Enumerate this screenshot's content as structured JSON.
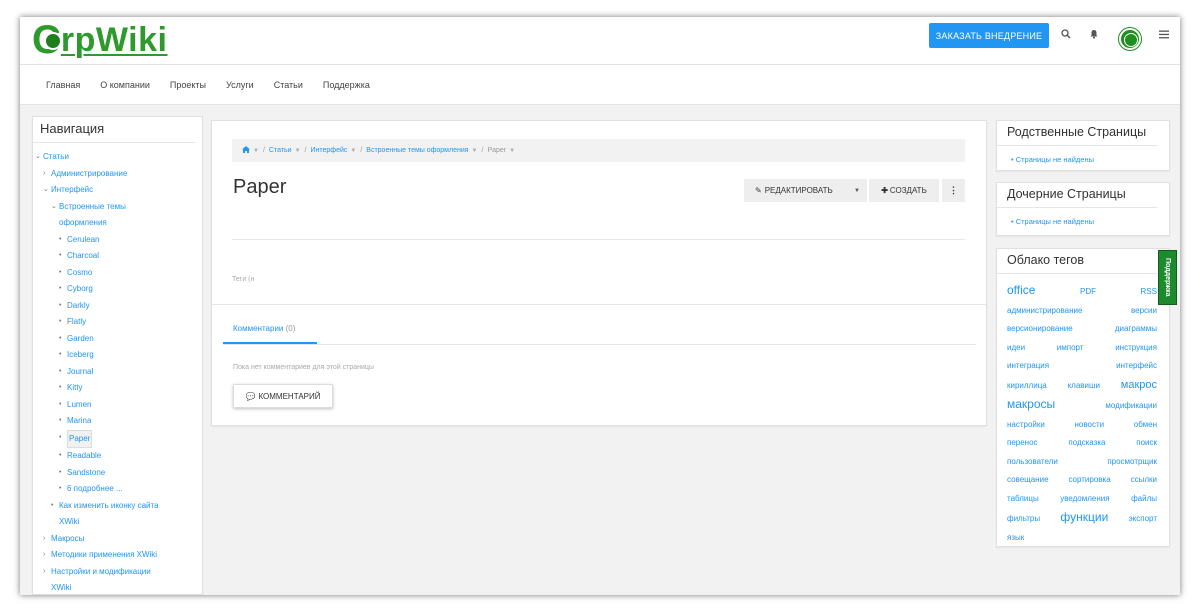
{
  "header": {
    "logo_text": "rpWiki",
    "logo_letter": "C",
    "order_button": "ЗАКАЗАТЬ ВНЕДРЕНИЕ",
    "icons": [
      "search-icon",
      "bell-icon",
      "avatar",
      "menu-icon"
    ]
  },
  "navbar": {
    "items": [
      "Главная",
      "О компании",
      "Проекты",
      "Услуги",
      "Статьи",
      "Поддержка"
    ]
  },
  "sidebar": {
    "title": "Навигация",
    "items": [
      {
        "label": "Статьи",
        "marker": "⌄",
        "indent": 0
      },
      {
        "label": "Администрирование",
        "marker": "›",
        "indent": 1
      },
      {
        "label": "Интерфейс",
        "marker": "⌄",
        "indent": 1
      },
      {
        "label": "Встроенные темы\nоформления",
        "marker": "⌄",
        "indent": 2
      },
      {
        "label": "Cerulean",
        "marker": "•",
        "indent": 3
      },
      {
        "label": "Charcoal",
        "marker": "•",
        "indent": 3
      },
      {
        "label": "Cosmo",
        "marker": "•",
        "indent": 3
      },
      {
        "label": "Cyborg",
        "marker": "•",
        "indent": 3
      },
      {
        "label": "Darkly",
        "marker": "•",
        "indent": 3
      },
      {
        "label": "Flatly",
        "marker": "•",
        "indent": 3
      },
      {
        "label": "Garden",
        "marker": "•",
        "indent": 3
      },
      {
        "label": "Iceberg",
        "marker": "•",
        "indent": 3
      },
      {
        "label": "Journal",
        "marker": "•",
        "indent": 3
      },
      {
        "label": "Kitty",
        "marker": "•",
        "indent": 3
      },
      {
        "label": "Lumen",
        "marker": "•",
        "indent": 3
      },
      {
        "label": "Marina",
        "marker": "•",
        "indent": 3
      },
      {
        "label": "Paper",
        "marker": "•",
        "indent": 3,
        "selected": true
      },
      {
        "label": "Readable",
        "marker": "•",
        "indent": 3
      },
      {
        "label": "Sandstone",
        "marker": "•",
        "indent": 3
      },
      {
        "label": "6 подробнее ...",
        "marker": "•",
        "indent": 3
      },
      {
        "label": "Как изменить иконку сайта\nXWiki",
        "marker": "•",
        "indent": 2
      },
      {
        "label": "Макросы",
        "marker": "›",
        "indent": 1
      },
      {
        "label": "Методики применения XWiki",
        "marker": "›",
        "indent": 1
      },
      {
        "label": "Настройки и модификации\nXWiki",
        "marker": "›",
        "indent": 1
      }
    ]
  },
  "breadcrumb": {
    "items": [
      "Статьи",
      "Интерфейс",
      "Встроенные темы оформления"
    ],
    "current": "Paper"
  },
  "page": {
    "title": "Paper",
    "edit_button": "РЕДАКТИРОВАТЬ",
    "create_button": "СОЗДАТЬ",
    "more_button": "⋮",
    "tags_label": "Теги (н",
    "comments_tab": "Комментарии",
    "comments_count": "(0)",
    "no_comments": "Пока нет комментариев для этой страницы",
    "comment_button": "КОММЕНТАРИЙ"
  },
  "related": {
    "title": "Родственные Страницы",
    "empty": "• Страницы не найдены"
  },
  "children": {
    "title": "Дочерние Страницы",
    "empty": "• Страницы не найдены"
  },
  "tag_cloud": {
    "title": "Облако тегов",
    "tags": [
      {
        "label": "office",
        "size": 12
      },
      {
        "label": "PDF",
        "size": 8
      },
      {
        "label": "RSS",
        "size": 8
      },
      {
        "label": "администрирование",
        "size": 8
      },
      {
        "label": "версии",
        "size": 8
      },
      {
        "label": "версионирование",
        "size": 8
      },
      {
        "label": "диаграммы",
        "size": 8
      },
      {
        "label": "идеи",
        "size": 8
      },
      {
        "label": "импорт",
        "size": 8
      },
      {
        "label": "инструкция",
        "size": 8
      },
      {
        "label": "интеграция",
        "size": 8
      },
      {
        "label": "интерфейс",
        "size": 8
      },
      {
        "label": "кириллица",
        "size": 8
      },
      {
        "label": "клавиши",
        "size": 8
      },
      {
        "label": "макрос",
        "size": 11
      },
      {
        "label": "макросы",
        "size": 12
      },
      {
        "label": "модификации",
        "size": 8
      },
      {
        "label": "настройки",
        "size": 8
      },
      {
        "label": "новости",
        "size": 8
      },
      {
        "label": "обмен",
        "size": 8
      },
      {
        "label": "перенос",
        "size": 8
      },
      {
        "label": "подсказка",
        "size": 8
      },
      {
        "label": "поиск",
        "size": 8
      },
      {
        "label": "пользователи",
        "size": 8
      },
      {
        "label": "просмотрщик",
        "size": 8
      },
      {
        "label": "совещание",
        "size": 8
      },
      {
        "label": "сортировка",
        "size": 8
      },
      {
        "label": "ссылки",
        "size": 8
      },
      {
        "label": "таблицы",
        "size": 8
      },
      {
        "label": "уведомления",
        "size": 8
      },
      {
        "label": "файлы",
        "size": 8
      },
      {
        "label": "фильтры",
        "size": 8
      },
      {
        "label": "функции",
        "size": 12
      },
      {
        "label": "экспорт",
        "size": 8
      },
      {
        "label": "язык",
        "size": 8
      }
    ],
    "rows": [
      [
        0,
        1,
        2
      ],
      [
        3,
        4
      ],
      [
        5,
        6
      ],
      [
        7,
        8,
        9
      ],
      [
        10,
        11
      ],
      [
        12,
        13,
        14
      ],
      [
        15,
        16
      ],
      [
        17,
        18,
        19
      ],
      [
        20,
        21,
        22
      ],
      [
        23,
        24
      ],
      [
        25,
        26,
        27
      ],
      [
        28,
        29,
        30
      ],
      [
        31,
        32,
        33
      ],
      [
        34
      ]
    ]
  },
  "support_tab": "Поддержка",
  "colors": {
    "accent": "#2196f3",
    "brand_green": "#2e9a2e"
  }
}
